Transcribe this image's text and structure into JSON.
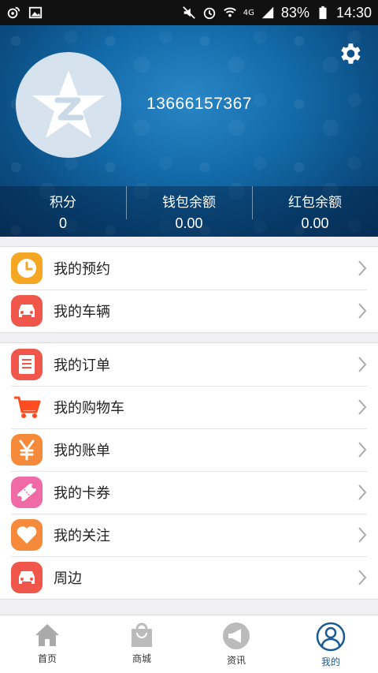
{
  "status_bar": {
    "battery": "83%",
    "time": "14:30",
    "network": "4G"
  },
  "profile": {
    "phone": "13666157367"
  },
  "stats": [
    {
      "label": "积分",
      "value": "0"
    },
    {
      "label": "钱包余额",
      "value": "0.00"
    },
    {
      "label": "红包余额",
      "value": "0.00"
    }
  ],
  "menu_group_1": [
    {
      "label": "我的预约",
      "icon": "clock-icon",
      "color": "#f5a623"
    },
    {
      "label": "我的车辆",
      "icon": "car-icon",
      "color": "#f0574a"
    }
  ],
  "menu_group_2": [
    {
      "label": "我的订单",
      "icon": "document-icon",
      "color": "#f0574a"
    },
    {
      "label": "我的购物车",
      "icon": "cart-icon",
      "color": "#ff5a1f"
    },
    {
      "label": "我的账单",
      "icon": "yen-icon",
      "color": "#f58a3a"
    },
    {
      "label": "我的卡券",
      "icon": "ticket-icon",
      "color": "#f06aa8"
    },
    {
      "label": "我的关注",
      "icon": "heart-icon",
      "color": "#f58a3a"
    },
    {
      "label": "周边",
      "icon": "car-icon",
      "color": "#f0574a"
    }
  ],
  "tabs": [
    {
      "label": "首页",
      "icon": "home-icon"
    },
    {
      "label": "商城",
      "icon": "shopping-bag-icon"
    },
    {
      "label": "资讯",
      "icon": "megaphone-icon"
    },
    {
      "label": "我的",
      "icon": "user-icon",
      "active": true
    }
  ]
}
